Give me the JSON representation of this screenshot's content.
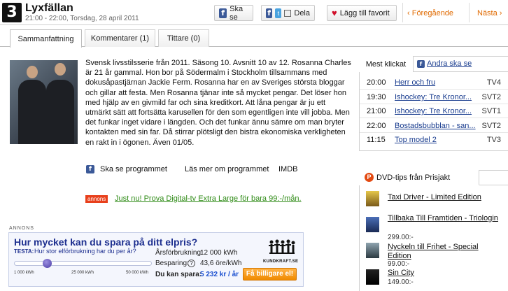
{
  "header": {
    "channel_number": "3",
    "title": "Lyxfällan",
    "airtime": "21:00 - 22:00, Torsdag, 28 april 2011",
    "buttons": {
      "ska_se": "Ska se",
      "dela": "Dela",
      "favorit": "Lägg till favorit"
    },
    "nav_prev": "‹ Föregående",
    "nav_next": "Nästa ›"
  },
  "tabs": [
    {
      "label": "Sammanfattning",
      "active": true
    },
    {
      "label": "Kommentarer (1)",
      "active": false
    },
    {
      "label": "Tittare (0)",
      "active": false
    }
  ],
  "main": {
    "description": "Svensk livsstilsserie från 2011. Säsong 10. Avsnitt 10 av 12. Rosanna Charles är 21 år gammal. Hon bor på Södermalm i Stockholm tillsammans med dokusåpastjärnan Jackie Ferm. Rosanna har en av Sveriges största bloggar och gillar att festa. Men Rosanna tjänar inte så mycket pengar. Det löser hon med hjälp av en givmild far och sina kreditkort. Att låna pengar är ju ett utmärkt sätt att fortsätta karusellen för den som egentligen inte vill jobba. Men det funkar inget vidare i längden. Och det funkar ännu sämre om man bryter kontakten med sin far. Då stirrar plötsligt den bistra ekonomiska verkligheten en rakt in i ögonen. Även 01/05.",
    "links": {
      "ska_se_programmet": "Ska se programmet",
      "las_mer": "Läs mer om programmet",
      "imdb": "IMDB"
    },
    "promo_badge": "annons",
    "promo_text": "Just nu! Prova Digital-tv Extra Large för bara 99:-/mån."
  },
  "ad": {
    "label": "ANNONS",
    "title": "Hur mycket kan du spara på ditt elpris?",
    "question_label": "TESTA:",
    "question": "Hur stor elförbrukning har du per år?",
    "slider_ticks": [
      "1 000 kWh",
      "25 000 kWh",
      "50 000 kWh"
    ],
    "slider_level": 0.24,
    "stats": [
      {
        "label": "Årsförbrukning:",
        "value": "12 000 kWh"
      },
      {
        "label": "Besparing:",
        "value": "43,6 öre/kWh"
      }
    ],
    "help": "?",
    "save_label": "Du kan spara:",
    "save_value": "5 232 kr / år",
    "brand": "KUNDKRAFT.SE",
    "cta": "Få billigare el!"
  },
  "schedule": {
    "tab_active": "Mest klickat",
    "tab_other": "Andra ska se",
    "rows": [
      {
        "time": "20:00",
        "program": "Herr och fru",
        "channel": "TV4"
      },
      {
        "time": "19:30",
        "program": "Ishockey: Tre Kronor...",
        "channel": "SVT2"
      },
      {
        "time": "21:00",
        "program": "Ishockey: Tre Kronor...",
        "channel": "SVT1"
      },
      {
        "time": "22:00",
        "program": "Bostadsbubblan - san...",
        "channel": "SVT2"
      },
      {
        "time": "11:15",
        "program": "Top model 2",
        "channel": "TV3"
      }
    ]
  },
  "dvd": {
    "tab_label": "DVD-tips från Prisjakt",
    "items": [
      {
        "title": "Taxi Driver - Limited Edition",
        "price": ""
      },
      {
        "title": "Tillbaka Till Framtiden - Triologin",
        "price": "299.00:-"
      },
      {
        "title": "Nyckeln till Frihet - Special Edition",
        "price": "99.00:-"
      },
      {
        "title": "Sin City",
        "price": "149.00:-"
      }
    ]
  },
  "colors": {
    "link": "#1a3d8f",
    "nav_accent": "#e06a00",
    "promo_green": "#2d8a14",
    "ad_blue": "#1d2f8f",
    "cta_orange": "#f08a00"
  }
}
